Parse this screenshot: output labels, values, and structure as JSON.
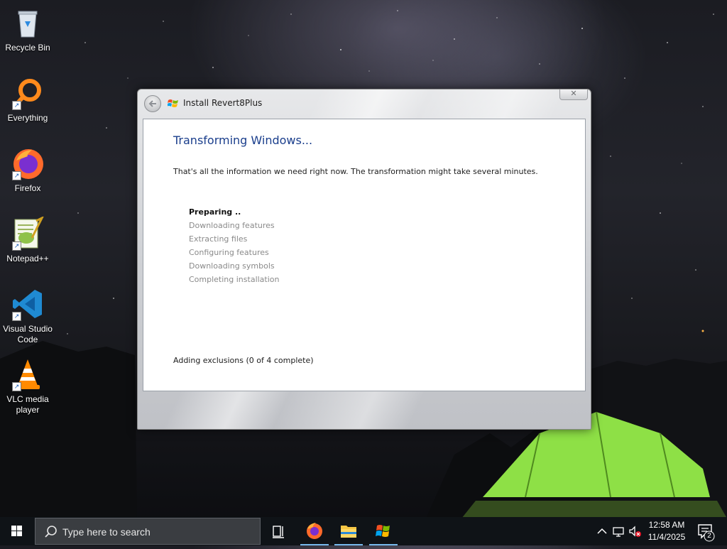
{
  "desktop": {
    "icons": [
      {
        "label": "Recycle Bin",
        "icon": "recycle-bin-icon"
      },
      {
        "label": "Everything",
        "icon": "everything-search-icon"
      },
      {
        "label": "Firefox",
        "icon": "firefox-icon"
      },
      {
        "label": "Notepad++",
        "icon": "notepad-plus-plus-icon"
      },
      {
        "label": "Visual Studio Code",
        "icon": "vscode-icon"
      },
      {
        "label": "VLC media player",
        "icon": "vlc-icon"
      }
    ]
  },
  "window": {
    "title": "Install Revert8Plus",
    "close_label": "✕",
    "heading": "Transforming Windows...",
    "info": "That's all the information we need right now. The transformation might take several minutes.",
    "steps": [
      {
        "label": "Preparing ..",
        "state": "active"
      },
      {
        "label": "Downloading features",
        "state": "pending"
      },
      {
        "label": "Extracting files",
        "state": "pending"
      },
      {
        "label": "Configuring features",
        "state": "pending"
      },
      {
        "label": "Downloading symbols",
        "state": "pending"
      },
      {
        "label": "Completing installation",
        "state": "pending"
      }
    ],
    "status": "Adding exclusions (0 of 4 complete)"
  },
  "taskbar": {
    "search_placeholder": "Type here to search",
    "apps": [
      "task-view-icon",
      "firefox-icon",
      "file-explorer-icon",
      "windows-installer-icon"
    ],
    "time": "12:58 AM",
    "date": "11/4/2025",
    "notification_count": "2"
  },
  "colors": {
    "heading": "#1a3e8c",
    "taskbar": "#0f1317",
    "search_box": "#3a3d41",
    "tent_green": "#8ee046"
  }
}
